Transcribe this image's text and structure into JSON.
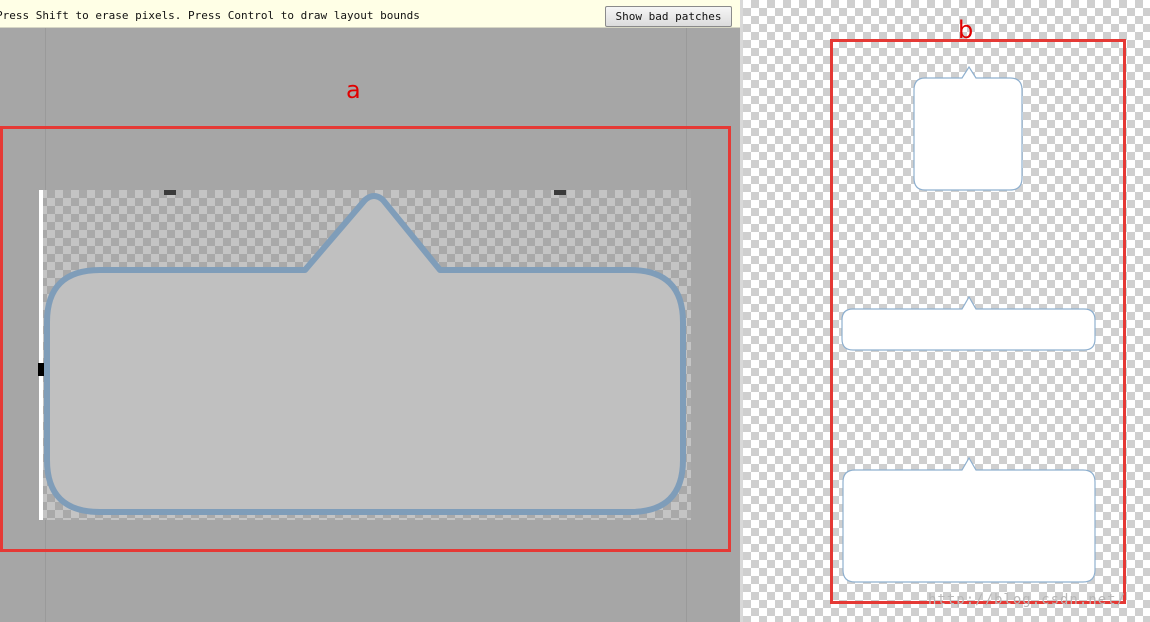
{
  "toolbar": {
    "hint_text": "Press Shift to erase pixels. Press Control to draw layout bounds",
    "show_bad_patches_label": "Show bad patches"
  },
  "labels": {
    "a": "a",
    "b": "b"
  },
  "watermark": "http://blog.csdn.net/",
  "colors": {
    "annotation_red": "#e53935",
    "bubble_stroke": "#7f9db9",
    "bubble_fill_editor": "#c0c0c0",
    "bubble_fill_preview": "#ffffff",
    "editor_background": "#a6a6a6"
  }
}
